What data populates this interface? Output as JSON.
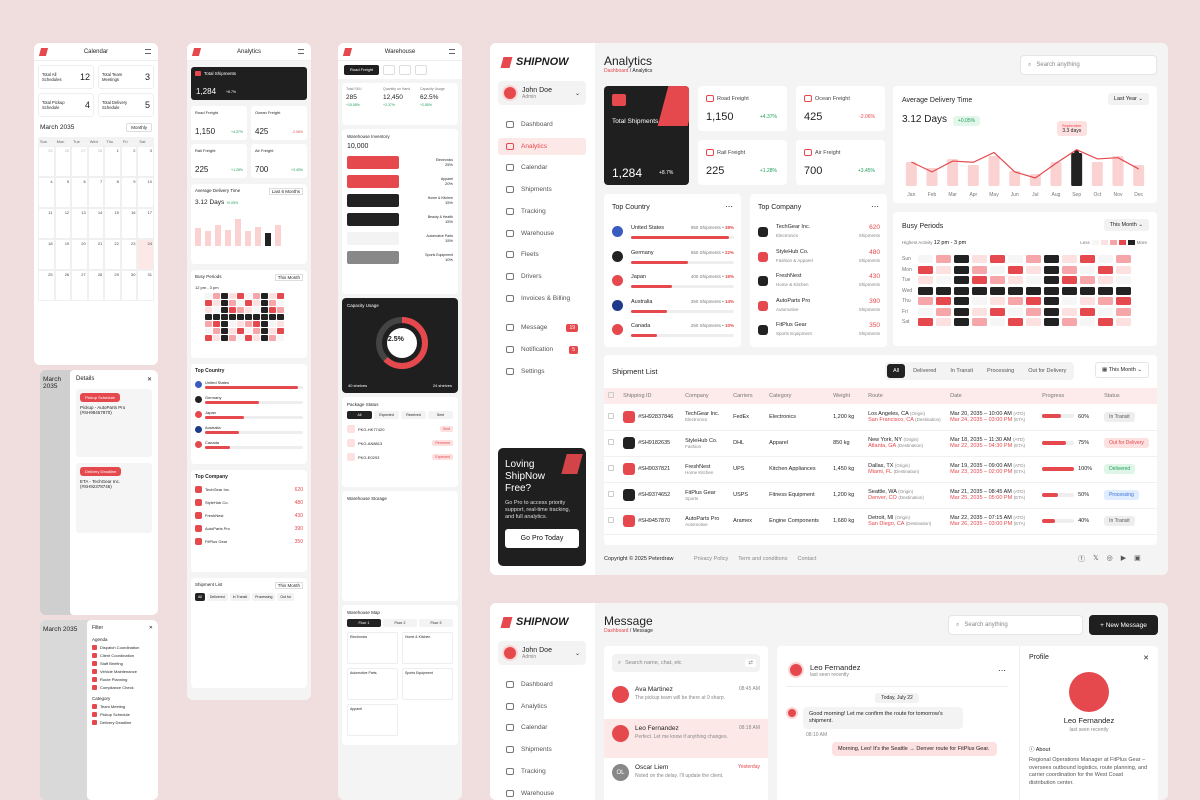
{
  "mobile_calendar": {
    "title": "Calendar",
    "stats": [
      {
        "label": "Total All Schedules",
        "value": "12"
      },
      {
        "label": "Total Team Meetings",
        "value": "3"
      },
      {
        "label": "Total Pickup Schedule",
        "value": "4"
      },
      {
        "label": "Total Delivery Schedule",
        "value": "5"
      }
    ],
    "month": "March 2035",
    "view": "Monthly",
    "days": [
      "Sun",
      "Mon",
      "Tue",
      "Wed",
      "Thu",
      "Fri",
      "Sat"
    ],
    "details_title": "Details",
    "ev1_tag": "Pickup Schedule",
    "ev1_title": "Pickup - AutoParts Pro (#SH98457870)",
    "ev2_tag": "Delivery Deadline",
    "ev2_title": "ETA - TechGear Inc. (#SH92378746)",
    "filter_title": "Filter",
    "agenda": "Agenda",
    "agenda_items": [
      "Dispatch Coordination",
      "Client Coordination",
      "Staff Briefing",
      "Vehicle Maintenance",
      "Route Planning",
      "Compliance Check"
    ],
    "category": "Category",
    "category_items": [
      "Team Meeting",
      "Pickup Schedule",
      "Delivery Deadline"
    ]
  },
  "mobile_analytics": {
    "title": "Analytics",
    "total_label": "Total Shipments",
    "total": "1,284",
    "total_pct": "+8.7%",
    "mini": [
      {
        "label": "Road Freight",
        "value": "1,150",
        "pct": "+4.37%"
      },
      {
        "label": "Ocean Freight",
        "value": "425",
        "pct": "-2.06%"
      },
      {
        "label": "Rail Freight",
        "value": "225",
        "pct": "+1.28%"
      },
      {
        "label": "Air Freight",
        "value": "700",
        "pct": "+3.45%"
      }
    ],
    "adt": "Average Delivery Time",
    "adt_range": "Last 6 Months",
    "adt_val": "3.12 Days",
    "adt_pct": "+0.05%",
    "busy": "Busy Periods",
    "busy_range": "This Month",
    "busy_hi": "12 pm - 3 pm",
    "country": "Top Country",
    "company": "Top Company",
    "shiplist": "Shipment List",
    "ship_range": "This Month",
    "tabs": [
      "All",
      "Delivered",
      "In Transit",
      "Processing",
      "Out for"
    ]
  },
  "mobile_warehouse": {
    "title": "Warehouse",
    "tabs": [
      "Road Freight"
    ],
    "kpis": [
      {
        "label": "Total SKU",
        "value": "285",
        "pct": "+15.58%"
      },
      {
        "label": "Quantity on Hand",
        "value": "12,450",
        "pct": "+2.37%"
      },
      {
        "label": "Capacity Usage",
        "value": "62.5%",
        "pct": "+2.85%"
      }
    ],
    "inv_title": "Warehouse Inventory",
    "inv_total": "10,000",
    "inv_items": [
      {
        "name": "Electronics",
        "pct": "25%"
      },
      {
        "name": "Apparel",
        "pct": "20%"
      },
      {
        "name": "Home & Kitchen",
        "pct": "15%"
      },
      {
        "name": "Beauty & Health",
        "pct": "15%"
      },
      {
        "name": "Automotive Parts",
        "pct": "15%"
      },
      {
        "name": "Sports Equipment",
        "pct": "10%"
      }
    ],
    "cap_title": "Capacity Usage",
    "cap_val": "62.5%",
    "cap_sub": "Total Usage",
    "cap_l": "40 shelves",
    "cap_r": "24 shelves",
    "pkg_title": "Package Status",
    "pkg_tabs": [
      "All",
      "Expected",
      "Received",
      "Sent"
    ],
    "pkgs": [
      {
        "id": "PKG-HK77420",
        "st": "Sent"
      },
      {
        "id": "PKG-AN8813",
        "st": "Received"
      },
      {
        "id": "PKG-E0293",
        "st": "Expected"
      }
    ],
    "stor_title": "Warehouse Storage",
    "map_title": "Warehouse Map",
    "floors": [
      "Floor 1",
      "Floor 2",
      "Floor 3"
    ],
    "zones": [
      "Electronics",
      "Home & Kitchen",
      "Automotive Parts",
      "Sports Equipment",
      "Apparel"
    ]
  },
  "desk1": {
    "brand": "SHIPNOW",
    "user": "John Doe",
    "role": "Admin",
    "nav": [
      {
        "label": "Dashboard"
      },
      {
        "label": "Analytics"
      },
      {
        "label": "Calendar"
      },
      {
        "label": "Shipments"
      },
      {
        "label": "Tracking"
      },
      {
        "label": "Warehouse"
      },
      {
        "label": "Fleets"
      },
      {
        "label": "Drivers"
      },
      {
        "label": "Invoices & Billing"
      },
      {
        "label": "Message",
        "badge": "19"
      },
      {
        "label": "Notification",
        "badge": "5"
      },
      {
        "label": "Settings"
      }
    ],
    "promo_title": "Loving ShipNow Free?",
    "promo_text": "Go Pro to access priority support, real-time tracking, and full analytics.",
    "promo_btn": "Go Pro Today",
    "page_title": "Analytics",
    "crumb_a": "Dashboard",
    "crumb_b": "Analytics",
    "search": "Search anything",
    "total_label": "Total Shipments",
    "total": "1,284",
    "total_pct": "+8.7%",
    "stats": [
      {
        "label": "Road Freight",
        "value": "1,150",
        "pct": "+4.37%"
      },
      {
        "label": "Ocean Freight",
        "value": "425",
        "pct": "-2.06%"
      },
      {
        "label": "Rail Freight",
        "value": "225",
        "pct": "+1.28%"
      },
      {
        "label": "Air Freight",
        "value": "700",
        "pct": "+3.45%"
      }
    ],
    "adt_title": "Average Delivery Time",
    "adt_range": "Last Year",
    "adt_val": "3.12 Days",
    "adt_pct": "+0.05%",
    "adt_tip_m": "September",
    "adt_tip_v": "3.3 days",
    "country_title": "Top Country",
    "countries": [
      {
        "name": "United States",
        "ship": "950 Shipments",
        "pct": "38%",
        "fill": 0.95,
        "flag": "#3a5bbf"
      },
      {
        "name": "Germany",
        "ship": "550 Shipments",
        "pct": "22%",
        "fill": 0.55,
        "flag": "#222"
      },
      {
        "name": "Japan",
        "ship": "400 Shipments",
        "pct": "16%",
        "fill": 0.4,
        "flag": "#e5484d"
      },
      {
        "name": "Australia",
        "ship": "350 Shipments",
        "pct": "14%",
        "fill": 0.35,
        "flag": "#1e3a8a"
      },
      {
        "name": "Canada",
        "ship": "250 Shipments",
        "pct": "10%",
        "fill": 0.25,
        "flag": "#e5484d"
      }
    ],
    "company_title": "Top Company",
    "companies": [
      {
        "name": "TechGear Inc.",
        "cat": "Electronics",
        "v": "620",
        "u": "Shipments"
      },
      {
        "name": "StyleHub Co.",
        "cat": "Fashion & Apparel",
        "v": "480",
        "u": "Shipments"
      },
      {
        "name": "FreshNest",
        "cat": "Home & Kitchen",
        "v": "430",
        "u": "Shipments"
      },
      {
        "name": "AutoParts Pro",
        "cat": "Automotive",
        "v": "390",
        "u": "Shipments"
      },
      {
        "name": "FitPlus Gear",
        "cat": "Sports Equipment",
        "v": "350",
        "u": "Shipments"
      }
    ],
    "busy_title": "Busy Periods",
    "busy_range": "This Month",
    "busy_hl_label": "Highest Activity",
    "busy_hl": "12 pm - 3 pm",
    "busy_less": "Less",
    "busy_more": "More",
    "busy_days": [
      "Sun",
      "Mon",
      "Tue",
      "Wed",
      "Thu",
      "Fri",
      "Sat"
    ],
    "ship_title": "Shipment List",
    "ship_tabs": [
      "All",
      "Delivered",
      "In Transit",
      "Processing",
      "Out for Delivery"
    ],
    "ship_range": "This Month",
    "ship_cols": [
      "Shipping ID",
      "Company",
      "Carriers",
      "Category",
      "Weight",
      "Route",
      "Date",
      "Progress",
      "Status"
    ],
    "ship_rows": [
      {
        "id": "#SH92837846",
        "co": "TechGear Inc.",
        "cat0": "Electronics",
        "car": "FedEx",
        "cat": "Electronics",
        "w": "1,200 kg",
        "from": "Los Angeles, CA",
        "from_t": "(Origin)",
        "to": "San Francisco, CA",
        "to_t": "(Destination)",
        "d1": "Mar 20, 2035 – 10:00 AM",
        "d1t": "(ATD)",
        "d2": "Mar 24, 2035 – 03:00 PM",
        "d2t": "(ETA)",
        "pr": "60%",
        "p": 0.6,
        "st": "In Transit"
      },
      {
        "id": "#SH9182635",
        "co": "StyleHub Co.",
        "cat0": "Fashion",
        "car": "DHL",
        "cat": "Apparel",
        "w": "850 kg",
        "from": "New York, NY",
        "from_t": "(Origin)",
        "to": "Atlanta, GA",
        "to_t": "(Destination)",
        "d1": "Mar 18, 2035 – 11:30 AM",
        "d1t": "(ATD)",
        "d2": "Mar 22, 2035 – 04:30 PM",
        "d2t": "(ETA)",
        "pr": "75%",
        "p": 0.75,
        "st": "Out for Delivery"
      },
      {
        "id": "#SH9037821",
        "co": "FreshNest",
        "cat0": "Home Kitchen",
        "car": "UPS",
        "cat": "Kitchen Appliances",
        "w": "1,450 kg",
        "from": "Dallas, TX",
        "from_t": "(Origin)",
        "to": "Miami, FL",
        "to_t": "(Destination)",
        "d1": "Mar 19, 2035 – 09:00 AM",
        "d1t": "(ATD)",
        "d2": "Mar 23, 2035 – 02:00 PM",
        "d2t": "(ETA)",
        "pr": "100%",
        "p": 1,
        "st": "Delivered"
      },
      {
        "id": "#SH9374652",
        "co": "FitPlus Gear",
        "cat0": "Sports",
        "car": "USPS",
        "cat": "Fitness Equipment",
        "w": "1,200 kg",
        "from": "Seattle, WA",
        "from_t": "(Origin)",
        "to": "Denver, CO",
        "to_t": "(Destination)",
        "d1": "Mar 21, 2035 – 08:45 AM",
        "d1t": "(ATD)",
        "d2": "Mar 25, 2035 – 05:00 PM",
        "d2t": "(ETA)",
        "pr": "50%",
        "p": 0.5,
        "st": "Processing"
      },
      {
        "id": "#SH9457870",
        "co": "AutoParts Pro",
        "cat0": "Automotive",
        "car": "Aramex",
        "cat": "Engine Components",
        "w": "1,680 kg",
        "from": "Detroit, MI",
        "from_t": "(Origin)",
        "to": "San Diego, CA",
        "to_t": "(Destination)",
        "d1": "Mar 22, 2035 – 07:15 AM",
        "d1t": "(ATD)",
        "d2": "Mar 26, 2035 – 03:00 PM",
        "d2t": "(ETA)",
        "pr": "40%",
        "p": 0.4,
        "st": "In Transit"
      }
    ],
    "copyright": "Copyright © 2025 Peterdraw",
    "footer_links": [
      "Privacy Policy",
      "Term and conditions",
      "Contact"
    ]
  },
  "chart_data": {
    "type": "bar",
    "categories": [
      "Jan",
      "Feb",
      "Mar",
      "Apr",
      "May",
      "Jun",
      "Jul",
      "Aug",
      "Sep",
      "Oct",
      "Nov",
      "Dec"
    ],
    "series": [
      {
        "values": [
          3.0,
          2.8,
          3.1,
          2.9,
          3.2,
          2.7,
          2.6,
          3.0,
          3.3,
          3.0,
          3.2,
          2.9
        ]
      }
    ]
  },
  "desk2": {
    "brand": "SHIPNOW",
    "user": "John Doe",
    "role": "Admin",
    "nav": [
      "Dashboard",
      "Analytics",
      "Calendar",
      "Shipments",
      "Tracking",
      "Warehouse"
    ],
    "page_title": "Message",
    "crumb_a": "Dashboard",
    "crumb_b": "Message",
    "search": "Search anything",
    "new_msg": "+ New Message",
    "chat_search": "Search name, chat, etc",
    "chats": [
      {
        "name": "Ava Martinez",
        "time": "08:45 AM",
        "msg": "The pickup team will be there at 9 sharp."
      },
      {
        "name": "Leo Fernandez",
        "time": "08:18 AM",
        "msg": "Perfect. Let me know if anything changes."
      },
      {
        "name": "Oscar Liem",
        "time": "Yesterday",
        "msg": "Noted on the delay. I'll update the client.",
        "init": "OL"
      }
    ],
    "conv_name": "Leo Fernandez",
    "conv_seen": "last seen recently",
    "day": "Today, July 22",
    "bubble1": "Good morning! Let me confirm the route for tomorrow's shipment.",
    "bubble1_t": "08:10 AM",
    "bubble2": "Morning, Leo! It's the Seattle → Denver route for FitPlus Gear.",
    "profile": "Profile",
    "prof_name": "Leo Fernandez",
    "prof_seen": "last seen recently",
    "about": "About",
    "about_text": "Regional Operations Manager at FitPlus Gear – oversees outbound logistics, route planning, and carrier coordination for the West Coast distribution center."
  }
}
